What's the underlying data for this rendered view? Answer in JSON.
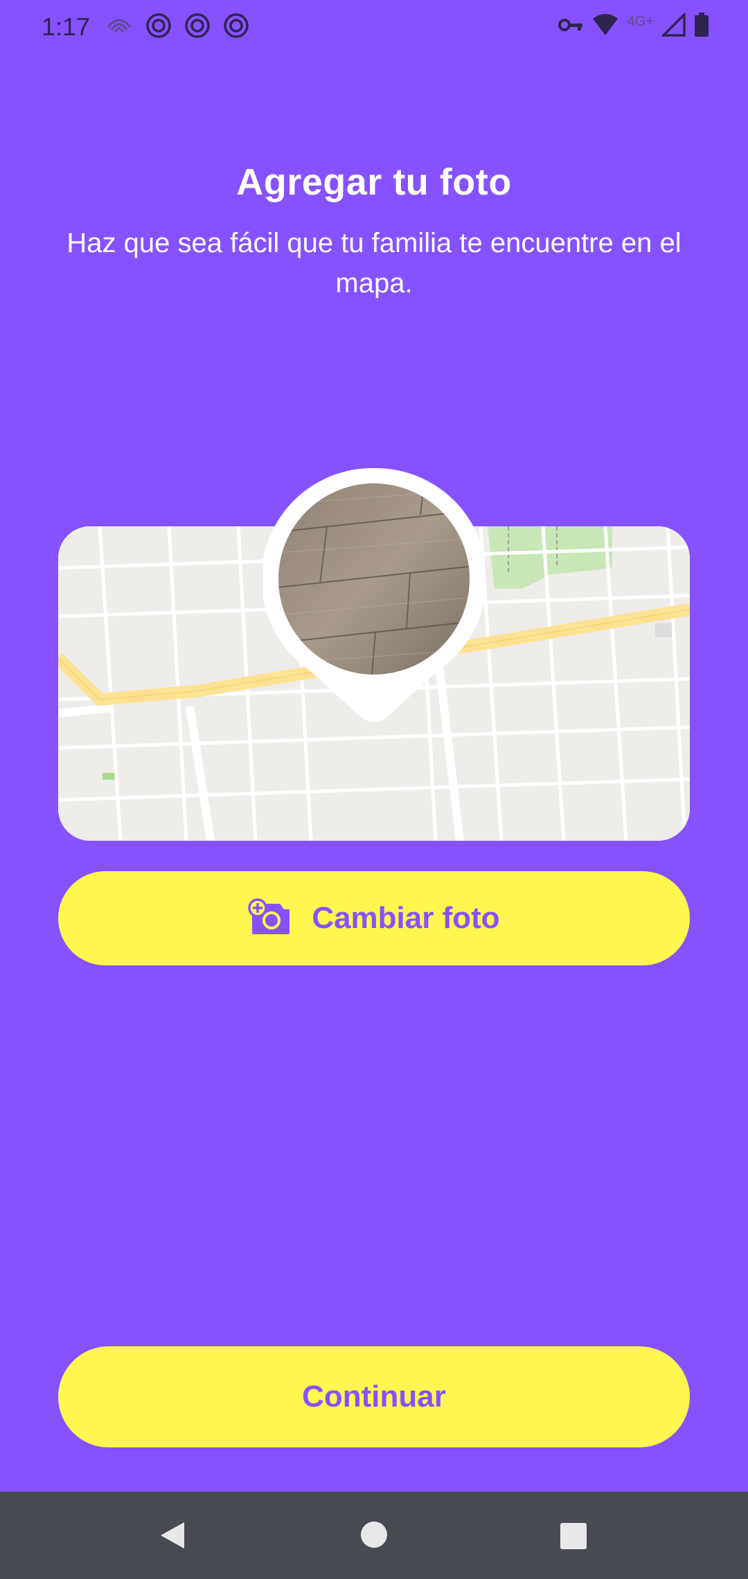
{
  "status_bar": {
    "time": "1:17",
    "network_label": "4G+",
    "left_icons": [
      "fingerprint-icon",
      "life360-notification-icon",
      "life360-notification-icon",
      "life360-notification-icon"
    ],
    "right_icons": [
      "vpn-key-icon",
      "wifi-icon",
      "cell-signal-icon",
      "battery-icon"
    ]
  },
  "header": {
    "title": "Agregar tu foto",
    "subtitle": "Haz que sea fácil que tu familia te encuentre en el mapa."
  },
  "photo_preview": {
    "map_icon": "map-background",
    "pin_icon": "location-pin-icon"
  },
  "buttons": {
    "change_photo_label": "Cambiar foto",
    "change_photo_icon": "add-photo-camera-icon",
    "continue_label": "Continuar"
  },
  "nav_bar": {
    "icons": [
      "back-icon",
      "home-icon",
      "recents-icon"
    ]
  },
  "colors": {
    "background": "#8652FF",
    "accent_yellow": "#FFF74F",
    "button_text": "#8652FF",
    "nav_bar": "#484C52"
  }
}
